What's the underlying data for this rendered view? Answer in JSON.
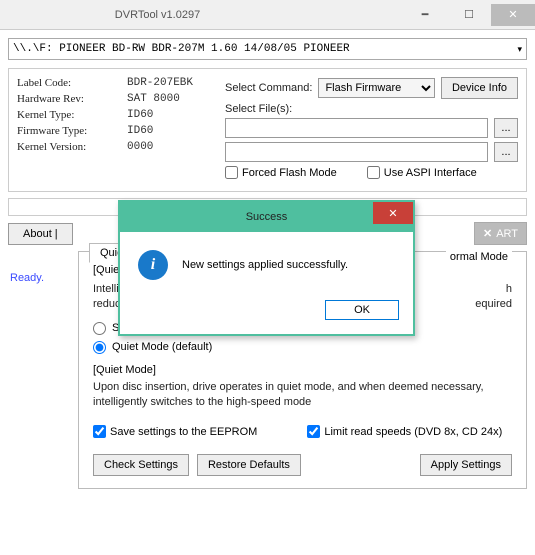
{
  "window": {
    "title": "DVRTool v1.0297"
  },
  "device": {
    "path": "\\\\.\\F: PIONEER  BD-RW   BDR-207M 1.60  14/08/05  PIONEER"
  },
  "info": {
    "label_code_k": "Label Code:",
    "label_code_v": "BDR-207EBK",
    "hardware_rev_k": "Hardware Rev:",
    "hardware_rev_v": "SAT 8000",
    "kernel_type_k": "Kernel Type:",
    "kernel_type_v": "ID60",
    "firmware_type_k": "Firmware Type:",
    "firmware_type_v": "ID60",
    "kernel_version_k": "Kernel Version:",
    "kernel_version_v": "0000"
  },
  "cmd": {
    "select_command": "Select Command:",
    "command_value": "Flash Firmware",
    "device_info": "Device Info",
    "select_files": "Select File(s):",
    "browse": "...",
    "forced_flash": "Forced Flash Mode",
    "use_aspi": "Use ASPI Interface"
  },
  "toolbar": {
    "about": "About |",
    "abort": "ART"
  },
  "status": {
    "ready": "Ready."
  },
  "tabs": {
    "tab1": "Quiet Driv",
    "right_label": "ormal Mode",
    "title": "[Quiet Driv",
    "desc1": "Intelligen",
    "desc2": "reduce th",
    "desc1_tail": "h",
    "desc2_tail": "equired",
    "radio_standard": "Stand",
    "radio_quiet": "Quiet Mode (default)",
    "sub_title": "[Quiet Mode]",
    "sub_desc": "Upon disc insertion, drive operates in quiet mode, and when deemed necessary, intelligently switches to the high-speed mode",
    "save_eeprom": "Save settings to the EEPROM",
    "limit_read": "Limit read speeds (DVD 8x, CD 24x)",
    "check": "Check Settings",
    "restore": "Restore Defaults",
    "apply": "Apply Settings"
  },
  "dialog": {
    "title": "Success",
    "msg": "New settings applied successfully.",
    "ok": "OK"
  }
}
